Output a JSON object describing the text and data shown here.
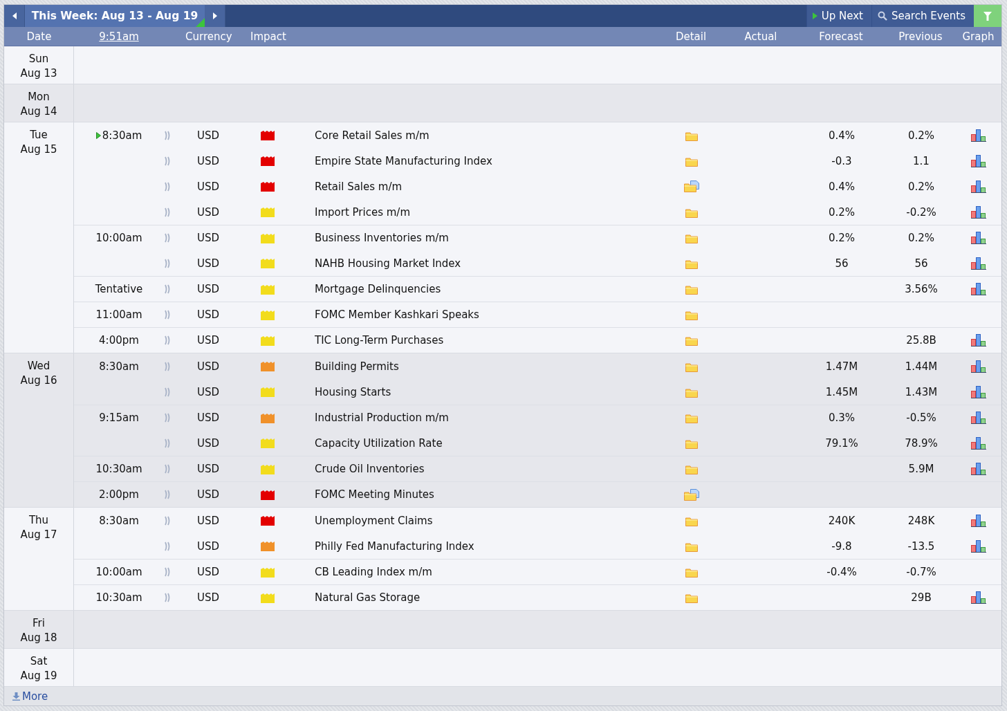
{
  "toolbar": {
    "week_label": "This Week: Aug 13 - Aug 19",
    "up_next": "Up Next",
    "search": "Search Events"
  },
  "columns": {
    "date": "Date",
    "time": "9:51am",
    "currency": "Currency",
    "impact": "Impact",
    "detail": "Detail",
    "actual": "Actual",
    "forecast": "Forecast",
    "previous": "Previous",
    "graph": "Graph"
  },
  "days": [
    {
      "day": "Sun",
      "date": "Aug 13"
    },
    {
      "day": "Mon",
      "date": "Aug 14"
    },
    {
      "day": "Tue",
      "date": "Aug 15",
      "events": [
        {
          "time": "8:30am",
          "up_next": true,
          "currency": "USD",
          "color": "#e30000",
          "title": "Core Retail Sales m/m",
          "kind": "folder",
          "forecast": "0.4%",
          "previous": "0.2%",
          "graph": true
        },
        {
          "up_next": false,
          "currency": "USD",
          "color": "#e30000",
          "title": "Empire State Manufacturing Index",
          "kind": "folder",
          "forecast": "-0.3",
          "previous": "1.1",
          "graph": true
        },
        {
          "up_next": false,
          "currency": "USD",
          "color": "#e30000",
          "title": "Retail Sales m/m",
          "kind": "document",
          "forecast": "0.4%",
          "previous": "0.2%",
          "graph": true
        },
        {
          "up_next": false,
          "currency": "USD",
          "color": "#f2dc1c",
          "title": "Import Prices m/m",
          "kind": "folder",
          "forecast": "0.2%",
          "previous": "-0.2%",
          "graph": true
        },
        {
          "time": "10:00am",
          "up_next": false,
          "currency": "USD",
          "color": "#f2dc1c",
          "title": "Business Inventories m/m",
          "kind": "folder",
          "forecast": "0.2%",
          "previous": "0.2%",
          "graph": true
        },
        {
          "up_next": false,
          "currency": "USD",
          "color": "#f2dc1c",
          "title": "NAHB Housing Market Index",
          "kind": "folder",
          "forecast": "56",
          "previous": "56",
          "graph": true
        },
        {
          "time": "Tentative",
          "up_next": false,
          "currency": "USD",
          "color": "#f2dc1c",
          "title": "Mortgage Delinquencies",
          "kind": "folder",
          "previous": "3.56%",
          "graph": true
        },
        {
          "time": "11:00am",
          "up_next": false,
          "currency": "USD",
          "color": "#f2dc1c",
          "title": "FOMC Member Kashkari Speaks",
          "kind": "folder",
          "graph": false
        },
        {
          "time": "4:00pm",
          "up_next": false,
          "currency": "USD",
          "color": "#f2dc1c",
          "title": "TIC Long-Term Purchases",
          "kind": "folder",
          "previous": "25.8B",
          "graph": true
        }
      ]
    },
    {
      "day": "Wed",
      "date": "Aug 16",
      "events": [
        {
          "time": "8:30am",
          "up_next": false,
          "currency": "USD",
          "color": "#f0912a",
          "title": "Building Permits",
          "kind": "folder",
          "forecast": "1.47M",
          "previous": "1.44M",
          "graph": true
        },
        {
          "up_next": false,
          "currency": "USD",
          "color": "#f2dc1c",
          "title": "Housing Starts",
          "kind": "folder",
          "forecast": "1.45M",
          "previous": "1.43M",
          "graph": true
        },
        {
          "time": "9:15am",
          "up_next": false,
          "currency": "USD",
          "color": "#f0912a",
          "title": "Industrial Production m/m",
          "kind": "folder",
          "forecast": "0.3%",
          "previous": "-0.5%",
          "graph": true
        },
        {
          "up_next": false,
          "currency": "USD",
          "color": "#f2dc1c",
          "title": "Capacity Utilization Rate",
          "kind": "folder",
          "forecast": "79.1%",
          "previous": "78.9%",
          "graph": true
        },
        {
          "time": "10:30am",
          "up_next": false,
          "currency": "USD",
          "color": "#f2dc1c",
          "title": "Crude Oil Inventories",
          "kind": "folder",
          "previous": "5.9M",
          "graph": true
        },
        {
          "time": "2:00pm",
          "up_next": false,
          "currency": "USD",
          "color": "#e30000",
          "title": "FOMC Meeting Minutes",
          "kind": "document",
          "graph": false
        }
      ]
    },
    {
      "day": "Thu",
      "date": "Aug 17",
      "events": [
        {
          "time": "8:30am",
          "up_next": false,
          "currency": "USD",
          "color": "#e30000",
          "title": "Unemployment Claims",
          "kind": "folder",
          "forecast": "240K",
          "previous": "248K",
          "graph": true
        },
        {
          "up_next": false,
          "currency": "USD",
          "color": "#f0912a",
          "title": "Philly Fed Manufacturing Index",
          "kind": "folder",
          "forecast": "-9.8",
          "previous": "-13.5",
          "graph": true
        },
        {
          "time": "10:00am",
          "up_next": false,
          "currency": "USD",
          "color": "#f2dc1c",
          "title": "CB Leading Index m/m",
          "kind": "folder",
          "forecast": "-0.4%",
          "previous": "-0.7%",
          "graph": false
        },
        {
          "time": "10:30am",
          "up_next": false,
          "currency": "USD",
          "color": "#f2dc1c",
          "title": "Natural Gas Storage",
          "kind": "folder",
          "previous": "29B",
          "graph": true
        }
      ]
    },
    {
      "day": "Fri",
      "date": "Aug 18"
    },
    {
      "day": "Sat",
      "date": "Aug 19"
    }
  ],
  "footer": {
    "more": "More"
  }
}
